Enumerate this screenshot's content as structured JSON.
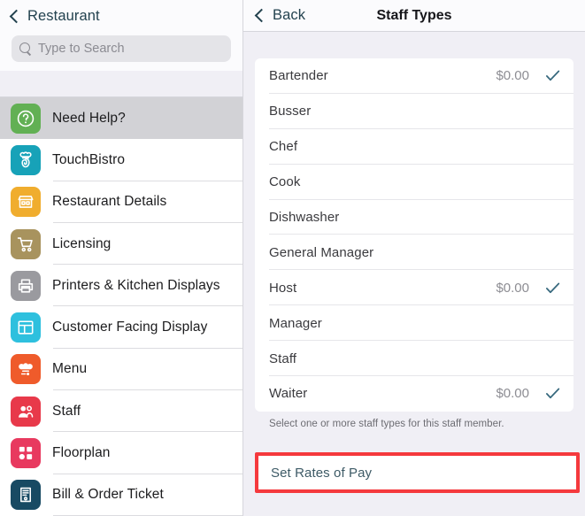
{
  "sidebar": {
    "back_label": "Restaurant",
    "search": {
      "placeholder": "Type to Search"
    },
    "items": [
      {
        "label": "Need Help?",
        "icon": "question-circle-icon",
        "color": "#62b054",
        "selected": true
      },
      {
        "label": "TouchBistro",
        "icon": "chef-fingerprint-icon",
        "color": "#17a2b8",
        "selected": false
      },
      {
        "label": "Restaurant Details",
        "icon": "storefront-icon",
        "color": "#f0ad2e",
        "selected": false
      },
      {
        "label": "Licensing",
        "icon": "shopping-cart-icon",
        "color": "#a8935e",
        "selected": false
      },
      {
        "label": "Printers & Kitchen Displays",
        "icon": "printer-icon",
        "color": "#9a9a9f",
        "selected": false
      },
      {
        "label": "Customer Facing Display",
        "icon": "layout-panel-icon",
        "color": "#2ec0de",
        "selected": false
      },
      {
        "label": "Menu",
        "icon": "chef-hat-utensil-icon",
        "color": "#ef5b2b",
        "selected": false
      },
      {
        "label": "Staff",
        "icon": "two-people-icon",
        "color": "#e8394a",
        "selected": false
      },
      {
        "label": "Floorplan",
        "icon": "floorplan-shapes-icon",
        "color": "#e8395f",
        "selected": false
      },
      {
        "label": "Bill & Order Ticket",
        "icon": "receipt-icon",
        "color": "#184a63",
        "selected": false
      }
    ]
  },
  "main": {
    "back_label": "Back",
    "title": "Staff Types",
    "staff_types": [
      {
        "name": "Bartender",
        "amount": "$0.00",
        "selected": true
      },
      {
        "name": "Busser",
        "amount": "",
        "selected": false
      },
      {
        "name": "Chef",
        "amount": "",
        "selected": false
      },
      {
        "name": "Cook",
        "amount": "",
        "selected": false
      },
      {
        "name": "Dishwasher",
        "amount": "",
        "selected": false
      },
      {
        "name": "General Manager",
        "amount": "",
        "selected": false
      },
      {
        "name": "Host",
        "amount": "$0.00",
        "selected": true
      },
      {
        "name": "Manager",
        "amount": "",
        "selected": false
      },
      {
        "name": "Staff",
        "amount": "",
        "selected": false
      },
      {
        "name": "Waiter",
        "amount": "$0.00",
        "selected": true
      }
    ],
    "footnote": "Select one or more staff types for this staff member.",
    "set_rates_label": "Set Rates of Pay",
    "highlight_color": "#f5393d",
    "checkmark_color": "#36687d"
  }
}
